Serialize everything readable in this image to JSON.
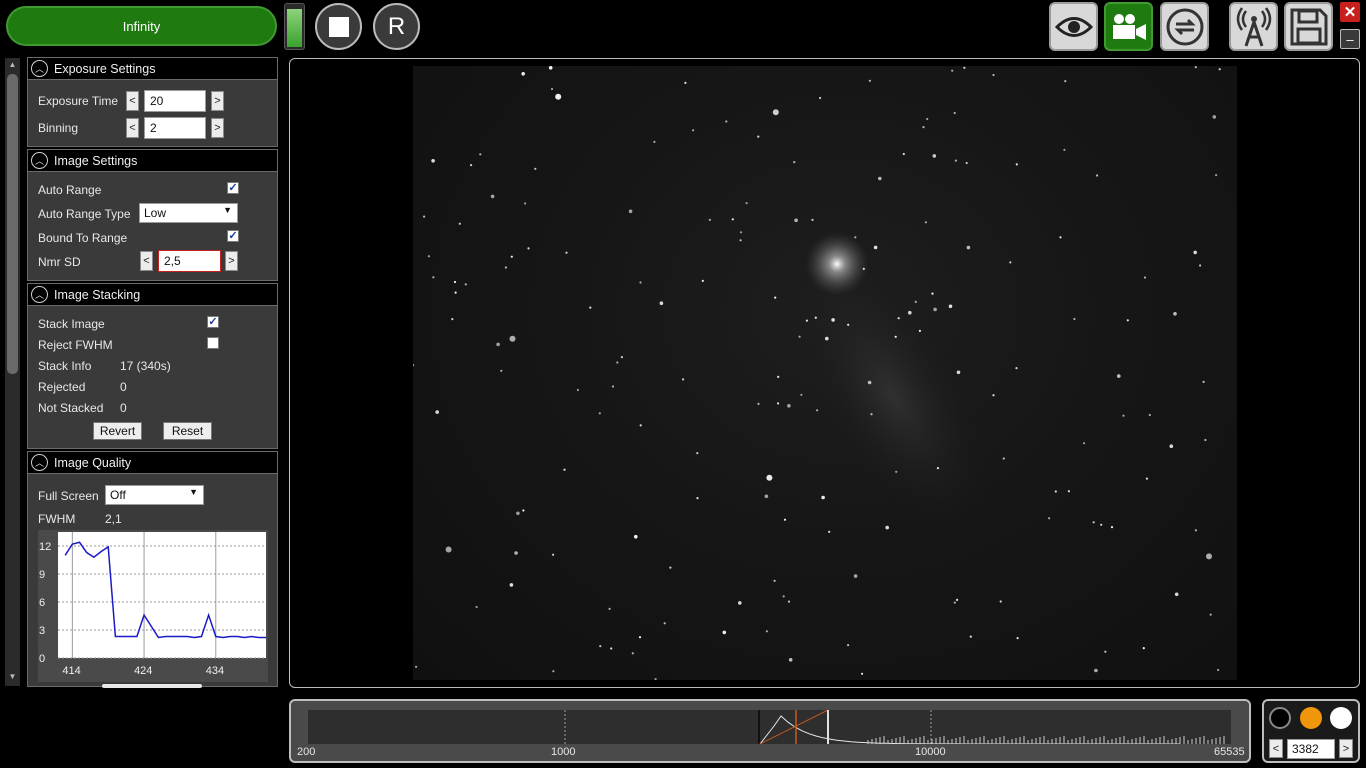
{
  "top": {
    "infinity_label": "Infinity",
    "reset_label": "R",
    "level_fraction": 0.85,
    "tool_icons": [
      "eye-icon",
      "video-camera-icon",
      "loop-icon",
      "antenna-icon",
      "save-icon"
    ],
    "close_label": "✕",
    "minimize_label": "–"
  },
  "exposure": {
    "title": "Exposure Settings",
    "time_label": "Exposure Time",
    "time_value": "20",
    "binning_label": "Binning",
    "binning_value": "2"
  },
  "image_settings": {
    "title": "Image Settings",
    "auto_range_label": "Auto Range",
    "auto_range_checked": true,
    "range_type_label": "Auto Range Type",
    "range_type_value": "Low",
    "bound_label": "Bound To Range",
    "bound_checked": true,
    "nmr_label": "Nmr SD",
    "nmr_value": "2,5"
  },
  "stacking": {
    "title": "Image Stacking",
    "stack_label": "Stack Image",
    "stack_checked": true,
    "reject_label": "Reject FWHM",
    "reject_checked": false,
    "info_label": "Stack Info",
    "info_value": "17 (340s)",
    "rejected_label": "Rejected",
    "rejected_value": "0",
    "not_stacked_label": "Not Stacked",
    "not_stacked_value": "0",
    "revert_label": "Revert",
    "reset_label": "Reset"
  },
  "quality": {
    "title": "Image Quality",
    "fullscreen_label": "Full Screen",
    "fullscreen_value": "Off",
    "fwhm_label": "FWHM",
    "fwhm_value": "2,1"
  },
  "chart_data": {
    "type": "line",
    "series": [
      {
        "values": [
          [
            413,
            11.0
          ],
          [
            414,
            12.2
          ],
          [
            415,
            12.4
          ],
          [
            416,
            11.3
          ],
          [
            417,
            10.8
          ],
          [
            418,
            11.4
          ],
          [
            419,
            11.9
          ],
          [
            420,
            2.3
          ],
          [
            421,
            2.3
          ],
          [
            422,
            2.3
          ],
          [
            423,
            2.3
          ],
          [
            424,
            4.6
          ],
          [
            425,
            3.4
          ],
          [
            426,
            2.2
          ],
          [
            427,
            2.3
          ],
          [
            428,
            2.3
          ],
          [
            429,
            2.3
          ],
          [
            430,
            2.3
          ],
          [
            431,
            2.2
          ],
          [
            432,
            2.3
          ],
          [
            433,
            4.6
          ],
          [
            434,
            2.3
          ],
          [
            435,
            2.2
          ],
          [
            436,
            2.3
          ],
          [
            437,
            2.3
          ],
          [
            438,
            2.2
          ],
          [
            439,
            2.3
          ],
          [
            440,
            2.2
          ],
          [
            441,
            2.2
          ]
        ]
      }
    ],
    "xlim": [
      412,
      441
    ],
    "ylim": [
      0,
      13.5
    ],
    "yticks": [
      0,
      3,
      6,
      9,
      12
    ],
    "xticks": [
      414,
      424,
      434
    ],
    "line_color": "#1a1ac8",
    "grid": true
  },
  "histogram": {
    "labels": [
      "200",
      "1000",
      "10000",
      "65535"
    ],
    "black_point_color": "#e0e0e0",
    "marker_color": "#c85a1a"
  },
  "color_panel": {
    "dots": [
      "#000000",
      "#f0960a",
      "#ffffff"
    ],
    "value": "3382",
    "prev_label": "<",
    "next_label": ">"
  }
}
